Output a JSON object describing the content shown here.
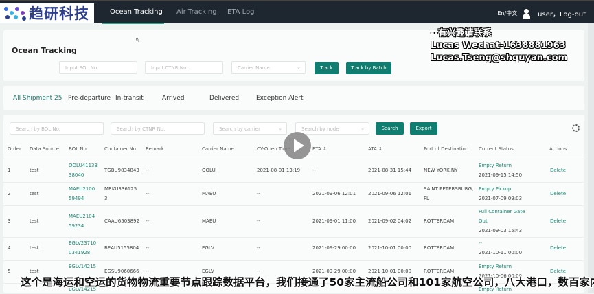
{
  "nav": {
    "logo_text": "趋研科技",
    "tabs": [
      "Ocean Tracking",
      "Air Tracking",
      "ETA Log"
    ],
    "lang": "En/中文",
    "user": "user，Log-out"
  },
  "ocean": {
    "title": "Ocean Tracking",
    "bol_placeholder": "Input BOL No.",
    "ctnr_placeholder": "Input CTNR No.",
    "carrier_placeholder": "Carrier Name",
    "track": "Track",
    "track_batch": "Track by Batch"
  },
  "status_tabs": [
    "All Shipment 25",
    "Pre-departure",
    "In-transit",
    "Arrived",
    "Delivered",
    "Exception Alert"
  ],
  "filters": {
    "bol": "Search by BOL No.",
    "ctnr": "Search by CTNR No.",
    "carrier": "Search by carrier",
    "node": "Search by node",
    "search": "Search",
    "export": "Export"
  },
  "table": {
    "headers": [
      "Order",
      "Data Source",
      "BOL No.",
      "Container No.",
      "Remark",
      "Carrier Name",
      "CY-Open Time",
      "ETA ⇕",
      "ATA ⇕",
      "Port of Destination",
      "Current Status",
      "Actions"
    ],
    "rows": [
      {
        "order": "1",
        "source": "test",
        "bol": [
          "OOLU41133",
          "38040"
        ],
        "ctnr": [
          "TGBU9834843"
        ],
        "remark": "--",
        "carrier": "OOLU",
        "cy": "2021-08-01 13:19",
        "eta": "--",
        "ata": "2021-08-31 15:44",
        "port": [
          "NEW YORK,NY"
        ],
        "status": [
          "Empty Return"
        ],
        "status_time": "2021-09-15 14:50",
        "action": "Delete"
      },
      {
        "order": "2",
        "source": "test",
        "bol": [
          "MAEU2100",
          "59494"
        ],
        "ctnr": [
          "MRKU336125",
          "3"
        ],
        "remark": "--",
        "carrier": "MAEU",
        "cy": "--",
        "eta": "2021-09-06 12:01",
        "ata": "2021-09-06 12:01",
        "port": [
          "SAINT PETERSBURG,",
          "FL"
        ],
        "status": [
          "Empty Pickup"
        ],
        "status_time": "2021-07-09 09:03",
        "action": "Delete"
      },
      {
        "order": "3",
        "source": "test",
        "bol": [
          "MAEU2104",
          "59234"
        ],
        "ctnr": [
          "CAAU6503892"
        ],
        "remark": "--",
        "carrier": "MAEU",
        "cy": "--",
        "eta": "2021-09-01 11:00",
        "ata": "2021-09-02 04:02",
        "port": [
          "ROTTERDAM"
        ],
        "status": [
          "Full Container Gate",
          "Out"
        ],
        "status_time": "2021-09-03 15:43",
        "action": "Delete"
      },
      {
        "order": "4",
        "source": "test",
        "bol": [
          "EGLV23710",
          "0341928"
        ],
        "ctnr": [
          "BEAU5155804"
        ],
        "remark": "--",
        "carrier": "EGLV",
        "cy": "--",
        "eta": "2021-09-29 00:00",
        "ata": "2021-10-01 00:00",
        "port": [
          "ROTTERDAM"
        ],
        "status": [
          "--"
        ],
        "status_time": "2021-10-11 00:00",
        "action": "Delete"
      },
      {
        "order": "5",
        "source": "test",
        "bol": [
          "EGLV14215",
          ""
        ],
        "ctnr": [
          "EGSU9060666"
        ],
        "remark": "--",
        "carrier": "EGLV",
        "cy": "--",
        "eta": "2021-09-29 00:00",
        "ata": "2021-10-01 00:00",
        "port": [
          "ROTTERDAM"
        ],
        "status": [
          "Empty Return"
        ],
        "status_time": "2021-10-06 00:00",
        "action": "Delete"
      },
      {
        "order": "",
        "source": "",
        "bol": [
          "EGLV14215",
          ""
        ],
        "ctnr": [
          ""
        ],
        "remark": "",
        "carrier": "",
        "cy": "",
        "eta": "",
        "ata": "",
        "port": [
          ""
        ],
        "status": [
          "Empty Return"
        ],
        "status_time": "",
        "action": ""
      }
    ]
  },
  "watermark": [
    "--有兴趣请联系",
    "Lucas Wechat-1638881963",
    "Lucas.Tseng@shquyan.com"
  ],
  "subtitle": "这个是海运和空运的货物物流重要节点跟踪数据平台，我们接通了50家主流船公司和101家航空公司，八大港口，数百家内外"
}
